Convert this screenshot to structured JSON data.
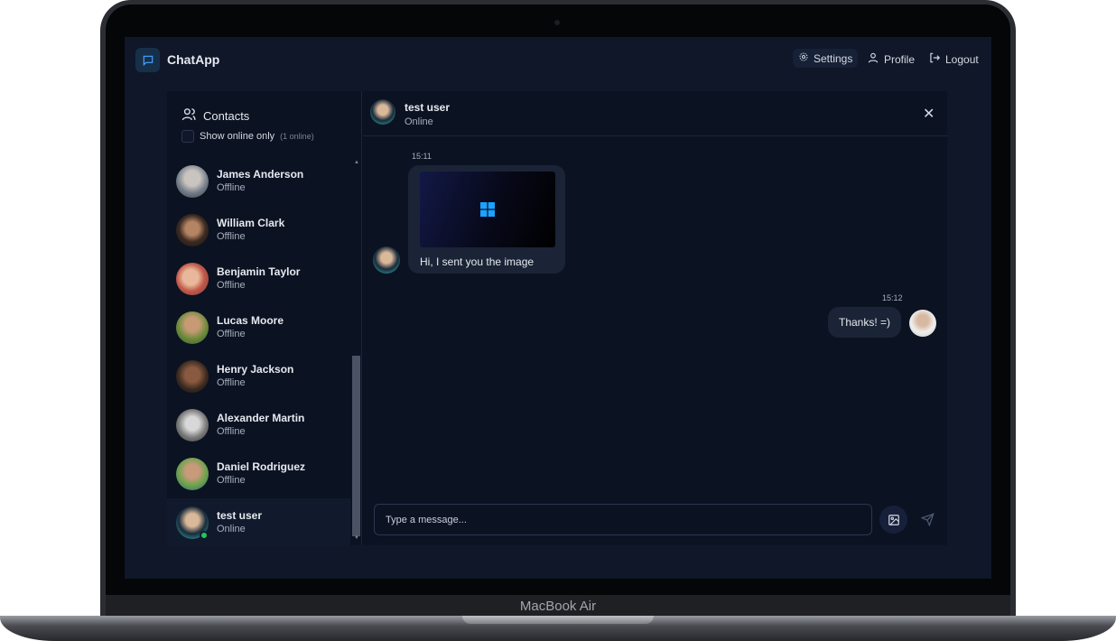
{
  "device": {
    "label": "MacBook Air"
  },
  "app": {
    "name": "ChatApp"
  },
  "nav": {
    "settings": "Settings",
    "profile": "Profile",
    "logout": "Logout"
  },
  "sidebar": {
    "title": "Contacts",
    "online_only_label": "Show online only",
    "online_count": "(1 online)",
    "contacts": [
      {
        "name": "James Anderson",
        "status": "Offline"
      },
      {
        "name": "William Clark",
        "status": "Offline"
      },
      {
        "name": "Benjamin Taylor",
        "status": "Offline"
      },
      {
        "name": "Lucas Moore",
        "status": "Offline"
      },
      {
        "name": "Henry Jackson",
        "status": "Offline"
      },
      {
        "name": "Alexander Martin",
        "status": "Offline"
      },
      {
        "name": "Daniel Rodriguez",
        "status": "Offline"
      },
      {
        "name": "test user",
        "status": "Online"
      }
    ]
  },
  "chat": {
    "name": "test user",
    "status": "Online",
    "messages": [
      {
        "time": "15:11",
        "text": "Hi, I sent you the image"
      },
      {
        "time": "15:12",
        "text": "Thanks! =)"
      }
    ],
    "input_placeholder": "Type a message..."
  },
  "colors": {
    "background": "#0f1729",
    "panel": "#0b1222",
    "bubble": "#1a2436",
    "online": "#22c55e",
    "accent": "#3b82f6"
  }
}
